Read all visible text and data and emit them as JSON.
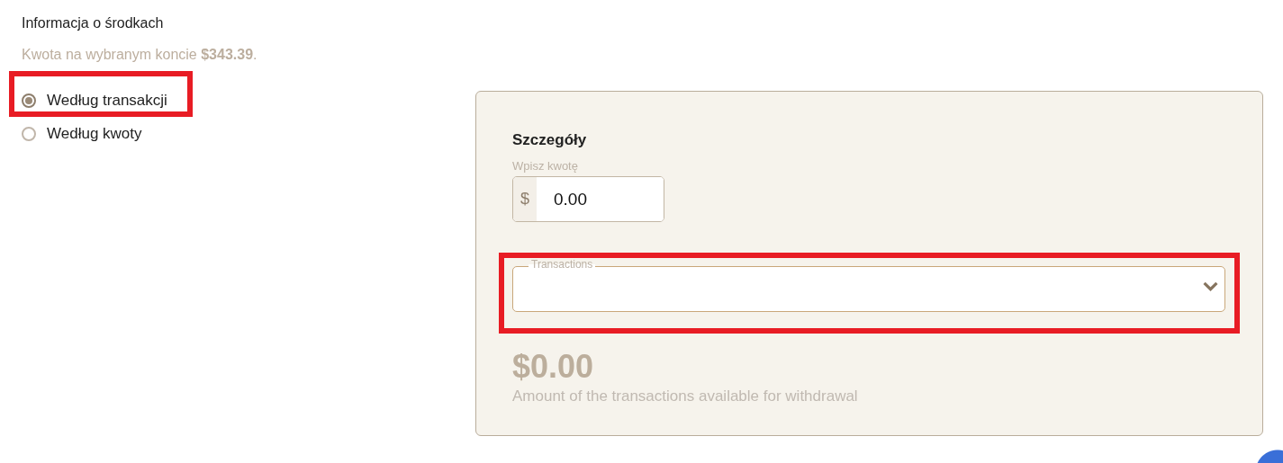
{
  "funds": {
    "title": "Informacja o środkach",
    "balance_text": "Kwota na wybranym koncie **$343.39**."
  },
  "mode_options": [
    {
      "label": "Według transakcji",
      "selected": true,
      "highlighted": true
    },
    {
      "label": "Według kwoty",
      "selected": false,
      "highlighted": false
    }
  ],
  "details": {
    "title": "Szczegóły",
    "amount_field": {
      "label": "Wpisz kwotę",
      "prefix": "$",
      "value": "0.00"
    },
    "transactions_select": {
      "label": "Transactions",
      "highlighted": true
    },
    "total": "$0.00",
    "total_caption": "Amount of the transactions available for withdrawal"
  }
}
